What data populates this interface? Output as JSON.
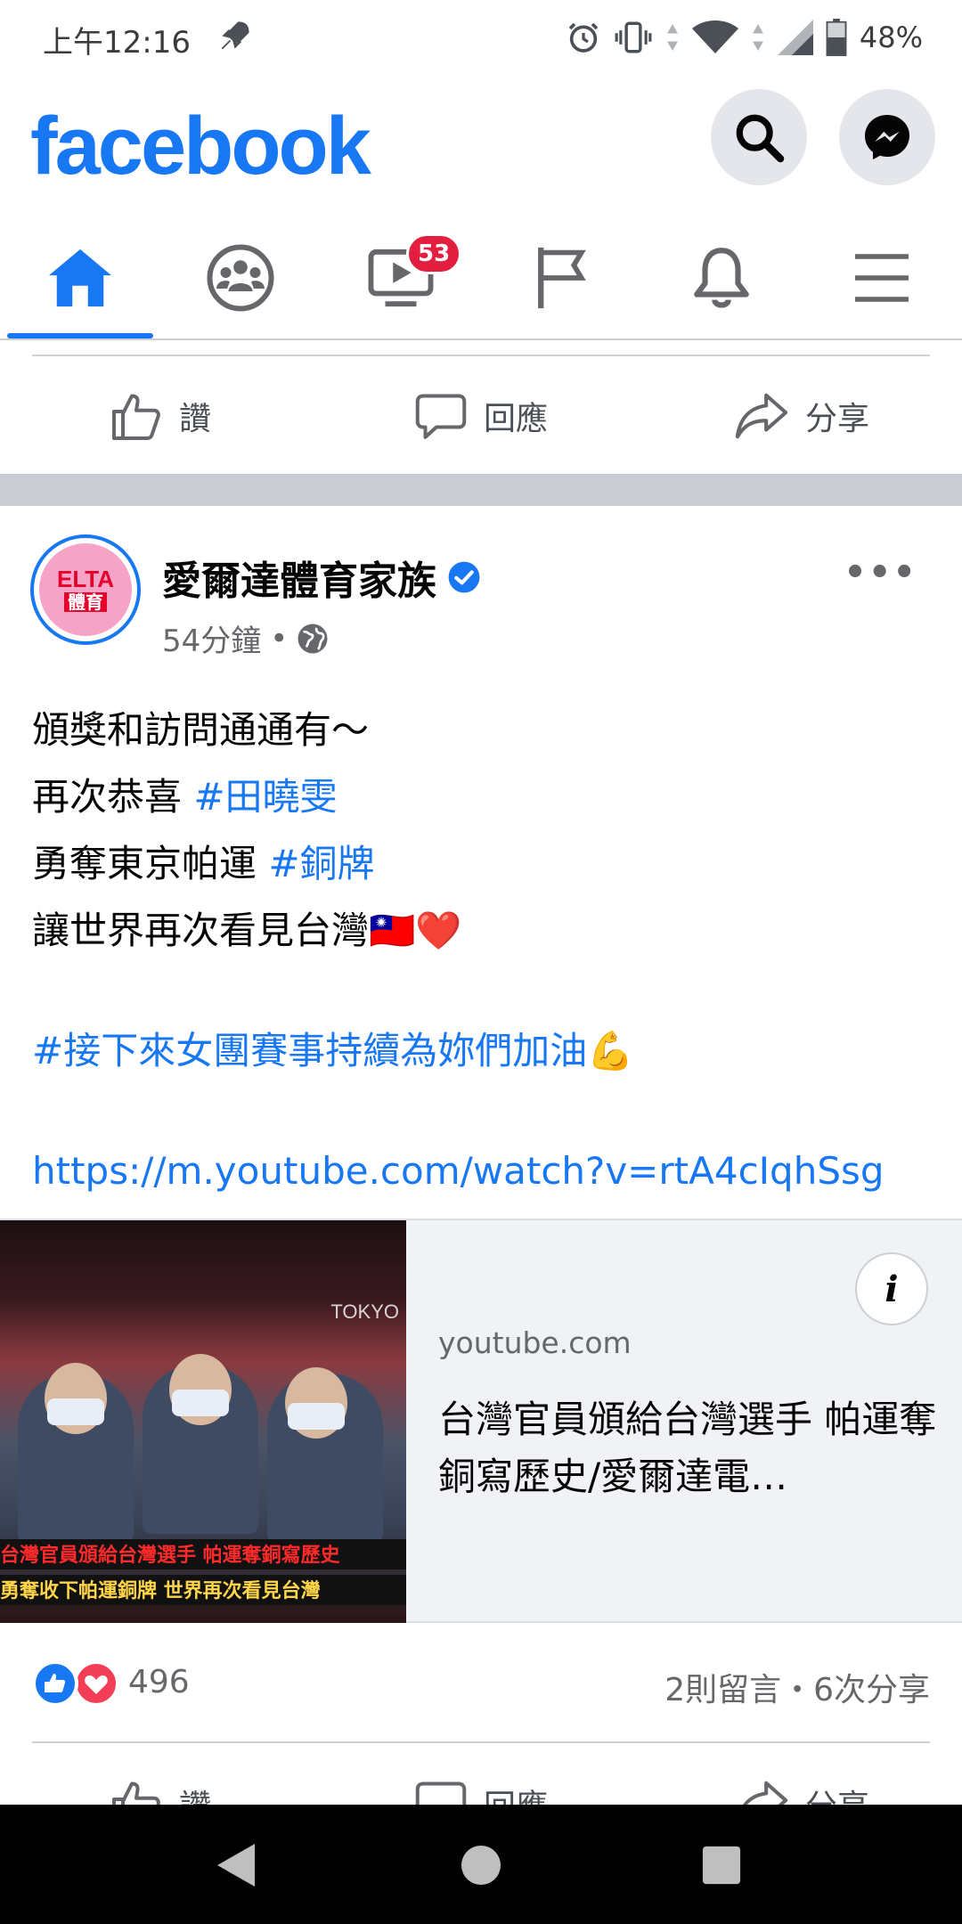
{
  "status_bar": {
    "time": "上午12:16",
    "battery": "48%",
    "icons": [
      "rocket-icon",
      "alarm-icon",
      "vibrate-icon",
      "data-arrows-icon",
      "wifi-icon",
      "signal-icon",
      "battery-icon"
    ]
  },
  "header": {
    "logo": "facebook",
    "search_icon": "search-icon",
    "messenger_icon": "messenger-icon"
  },
  "nav": {
    "items": [
      {
        "name": "home",
        "icon": "home-icon",
        "active": true
      },
      {
        "name": "groups",
        "icon": "groups-icon",
        "active": false
      },
      {
        "name": "watch",
        "icon": "watch-icon",
        "badge": "53",
        "active": false
      },
      {
        "name": "pages",
        "icon": "flag-icon",
        "active": false
      },
      {
        "name": "notifications",
        "icon": "bell-icon",
        "active": false
      },
      {
        "name": "menu",
        "icon": "menu-icon",
        "active": false
      }
    ]
  },
  "actions": {
    "like": "讚",
    "comment": "回應",
    "share": "分享"
  },
  "post": {
    "page_name": "愛爾達體育家族",
    "verified": true,
    "time": "54分鐘",
    "privacy_icon": "globe-icon",
    "avatar_text_top": "ELTA",
    "avatar_text_bottom": "體育",
    "lines": [
      {
        "text": "頒獎和訪問通通有～",
        "tag": ""
      },
      {
        "text": "再次恭喜 ",
        "tag": "#田曉雯"
      },
      {
        "text": "勇奪東京帕運 ",
        "tag": "#銅牌"
      },
      {
        "text": "讓世界再次看見台灣🇹🇼❤️",
        "tag": ""
      }
    ],
    "hashtag_line": "#接下來女團賽事持續為妳們加油",
    "hashtag_emoji": "💪",
    "url": "https://m.youtube.com/watch?v=rtA4cIqhSsg"
  },
  "preview": {
    "domain": "youtube.com",
    "title": "台灣官員頒給台灣選手 帕運奪銅寫歷史/愛爾達電…",
    "thumb_label": "TOKYO",
    "thumb_caption_1": "台灣官員頒給台灣選手 帕運奪銅寫歷史",
    "thumb_caption_2": "勇奪收下帕運銅牌 世界再次看見台灣"
  },
  "reactions": {
    "count": "496",
    "summary": "2則留言・6次分享"
  },
  "colors": {
    "brand": "#1877f2",
    "badge": "#e41e3f",
    "text_secondary": "#65676b"
  }
}
